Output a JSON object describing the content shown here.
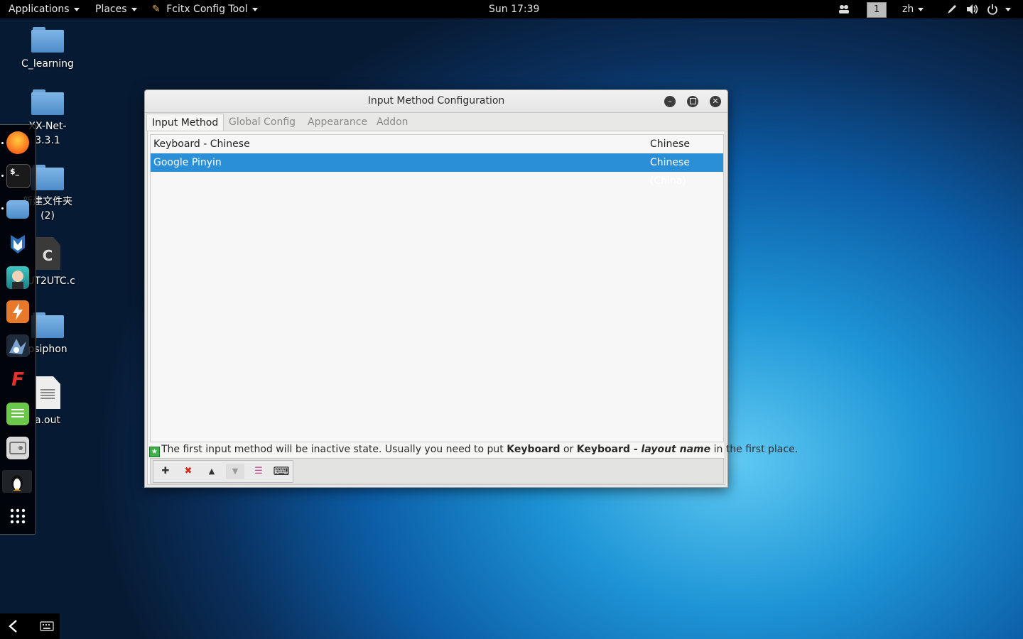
{
  "topbar": {
    "applications": "Applications",
    "places": "Places",
    "active_app": "Fcitx Config Tool",
    "clock": "Sun 17:39",
    "workspace": "1",
    "language": "zh"
  },
  "desktop": {
    "icons": [
      {
        "label": "C_learning"
      },
      {
        "label": "XX-Net-\n3.3.1"
      },
      {
        "label": "新建文件夹\n(2)"
      },
      {
        "label": "UT2UTC.c",
        "glyph": "C"
      },
      {
        "label": "psiphon"
      },
      {
        "label": "a.out"
      }
    ]
  },
  "dock": {
    "apps": [
      "firefox-icon",
      "terminal-icon",
      "files-icon",
      "metasploit-icon",
      "avatar-app-icon",
      "burpsuite-icon",
      "bird-tool-icon",
      "flashlight-icon",
      "text-editor-icon",
      "config-tool-icon",
      "tux-icon",
      "app-grid-icon"
    ],
    "terminal_glyph": "$_"
  },
  "window": {
    "title": "Input Method Configuration",
    "tabs": [
      "Input Method",
      "Global Config",
      "Appearance",
      "Addon"
    ],
    "rows": [
      {
        "name": "Keyboard - Chinese",
        "language": "Chinese",
        "selected": false
      },
      {
        "name": "Google Pinyin",
        "language": "Chinese (China)",
        "selected": true
      }
    ],
    "info": {
      "p1": "The first input method will be inactive state. Usually you need to put ",
      "b1": "Keyboard",
      "p2": " or ",
      "b2": "Keyboard - ",
      "bi": "layout name",
      "p3": " in the first place."
    },
    "toolbar": {
      "add": "✚",
      "remove": "✖",
      "up": "▲",
      "down": "▼",
      "configure": "☰",
      "keyboard": "⌨"
    }
  },
  "colors": {
    "selection": "#2a8fd6",
    "topbar": "#000000"
  }
}
